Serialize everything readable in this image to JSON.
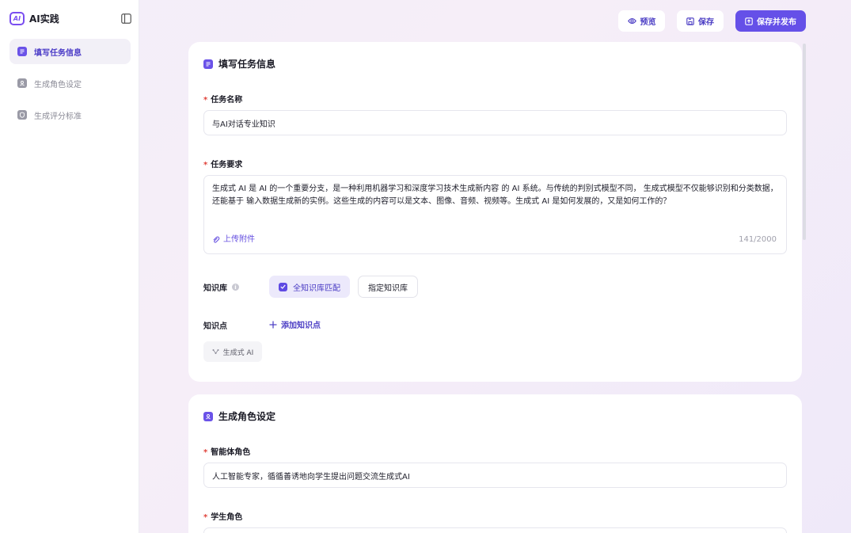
{
  "sidebar": {
    "brand_logo": "AI",
    "brand_name": "AI实践",
    "items": [
      {
        "label": "填写任务信息",
        "active": true
      },
      {
        "label": "生成角色设定",
        "active": false
      },
      {
        "label": "生成评分标准",
        "active": false
      }
    ]
  },
  "toolbar": {
    "preview_label": "预览",
    "save_label": "保存",
    "publish_label": "保存并发布"
  },
  "task_card": {
    "title": "填写任务信息",
    "name_label": "任务名称",
    "name_value": "与AI对话专业知识",
    "req_label": "任务要求",
    "req_value": "生成式 AI 是 AI 的一个重要分支，是一种利用机器学习和深度学习技术生成新内容 的 AI 系统。与传统的判别式模型不同， 生成式模型不仅能够识别和分类数据，还能基于 输入数据生成新的实例。这些生成的内容可以是文本、图像、音频、视频等。生成式 AI 是如何发展的，又是如何工作的？",
    "upload_label": "上传附件",
    "counter": "141/2000",
    "kb_label": "知识库",
    "kb_all": "全知识库匹配",
    "kb_specified": "指定知识库",
    "kp_label": "知识点",
    "kp_add": "添加知识点",
    "kp_tag": "生成式 AI"
  },
  "role_card": {
    "title": "生成角色设定",
    "agent_label": "智能体角色",
    "agent_value": "人工智能专家，循循善诱地向学生提出问题交流生成式AI",
    "student_label": "学生角色"
  },
  "colors": {
    "accent": "#6550e8",
    "required": "#e0423a"
  }
}
